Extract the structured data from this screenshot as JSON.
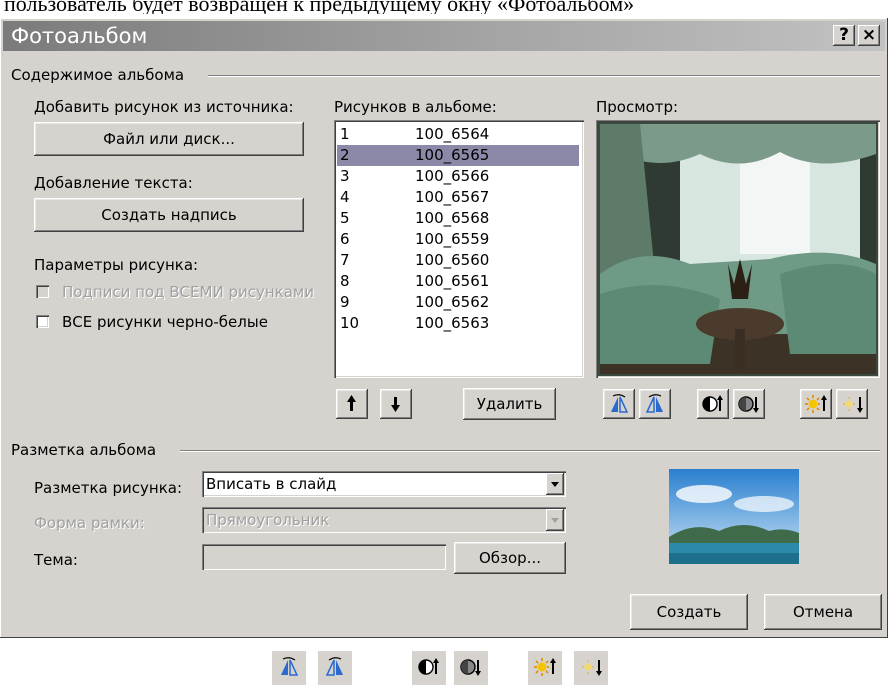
{
  "caption": "пользователь будет возвращен к предыдущему окну «Фотоальбом»",
  "window": {
    "title": "Фотоальбом",
    "help_label": "?",
    "close_label": "×"
  },
  "content_group": {
    "title": "Содержимое альбома",
    "add_picture_label": "Добавить рисунок из источника:",
    "file_button": "Файл или диск...",
    "add_text_label": "Добавление текста:",
    "caption_button": "Создать надпись",
    "params_label": "Параметры рисунка:",
    "captions_checkbox": {
      "label": "Подписи под ВСЕМИ рисунками",
      "checked": false,
      "enabled": false
    },
    "bw_checkbox": {
      "label": "ВСЕ рисунки черно-белые",
      "checked": false,
      "enabled": true
    }
  },
  "album_list": {
    "label": "Рисунков в альбоме:",
    "selected_index": 1,
    "items": [
      {
        "num": "1",
        "name": "100_6564"
      },
      {
        "num": "2",
        "name": "100_6565"
      },
      {
        "num": "3",
        "name": "100_6566"
      },
      {
        "num": "4",
        "name": "100_6567"
      },
      {
        "num": "5",
        "name": "100_6568"
      },
      {
        "num": "6",
        "name": "100_6559"
      },
      {
        "num": "7",
        "name": "100_6560"
      },
      {
        "num": "8",
        "name": "100_6561"
      },
      {
        "num": "9",
        "name": "100_6562"
      },
      {
        "num": "10",
        "name": "100_6563"
      }
    ],
    "up_icon": "arrow-up-icon",
    "down_icon": "arrow-down-icon",
    "delete_button": "Удалить"
  },
  "preview": {
    "label": "Просмотр:",
    "tools": [
      "rotate-left-icon",
      "rotate-right-icon",
      "contrast-up-icon",
      "contrast-down-icon",
      "brightness-up-icon",
      "brightness-down-icon"
    ]
  },
  "layout_group": {
    "title": "Разметка альбома",
    "picture_layout_label": "Разметка рисунка:",
    "picture_layout_value": "Вписать в слайд",
    "frame_shape_label": "Форма рамки:",
    "frame_shape_value": "Прямоугольник",
    "theme_label": "Тема:",
    "theme_value": "",
    "browse_button": "Обзор..."
  },
  "actions": {
    "create_button": "Создать",
    "cancel_button": "Отмена"
  },
  "colors": {
    "dialog_bg": "#d6d3ce",
    "selection": "#8a8aa8",
    "titlebar": "#7b7b7b"
  }
}
